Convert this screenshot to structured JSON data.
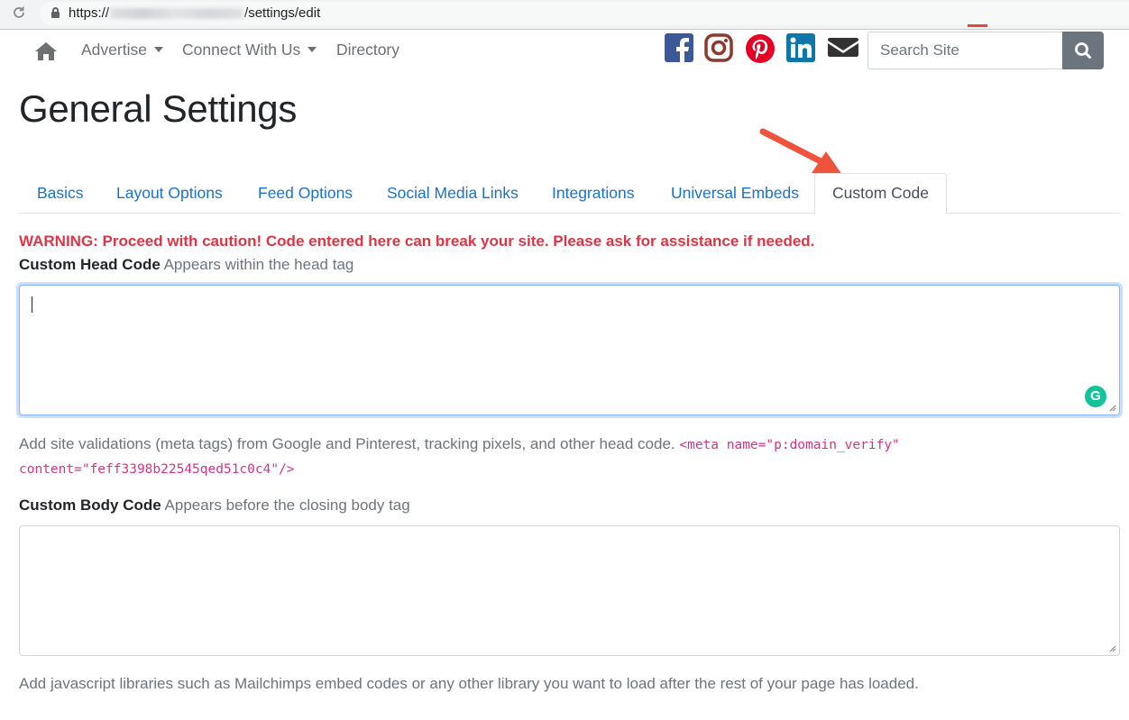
{
  "browser": {
    "url_prefix": "https://",
    "url_suffix": "/settings/edit"
  },
  "nav": {
    "advertise": "Advertise",
    "connect": "Connect With Us",
    "directory": "Directory",
    "search_placeholder": "Search Site",
    "social": [
      "facebook-icon",
      "instagram-icon",
      "pinterest-icon",
      "linkedin-icon",
      "envelope-icon"
    ]
  },
  "page": {
    "title": "General Settings"
  },
  "tabs": [
    {
      "label": "Basics",
      "active": false
    },
    {
      "label": "Layout Options",
      "active": false
    },
    {
      "label": "Feed Options",
      "active": false
    },
    {
      "label": "Social Media Links",
      "active": false
    },
    {
      "label": "Integrations",
      "active": false
    },
    {
      "label": "Universal Embeds",
      "active": false
    },
    {
      "label": "Custom Code",
      "active": true
    }
  ],
  "warning": "WARNING: Proceed with caution! Code entered here can break your site. Please ask for assistance if needed.",
  "head_code": {
    "label": "Custom Head Code",
    "sublabel": "Appears within the head tag",
    "value": "",
    "help": "Add site validations (meta tags) from Google and Pinterest, tracking pixels, and other head code.",
    "example_line1": "<meta name=\"p:domain_verify\"",
    "example_line2": "content=\"feff3398b22545qed51c0c4\"/>"
  },
  "body_code": {
    "label": "Custom Body Code",
    "sublabel": "Appears before the closing body tag",
    "value": "",
    "help": "Add javascript libraries such as Mailchimps embed codes or any other library you want to load after the rest of your page has loaded."
  },
  "colors": {
    "link": "#1a73c8",
    "warning": "#dc3545",
    "code": "#d63384",
    "facebook": "#3b5998",
    "instagram": "#8a3ab9",
    "pinterest": "#e60023",
    "linkedin": "#0e76a8",
    "envelope": "#333333",
    "annotation_arrow": "#f0533c"
  }
}
